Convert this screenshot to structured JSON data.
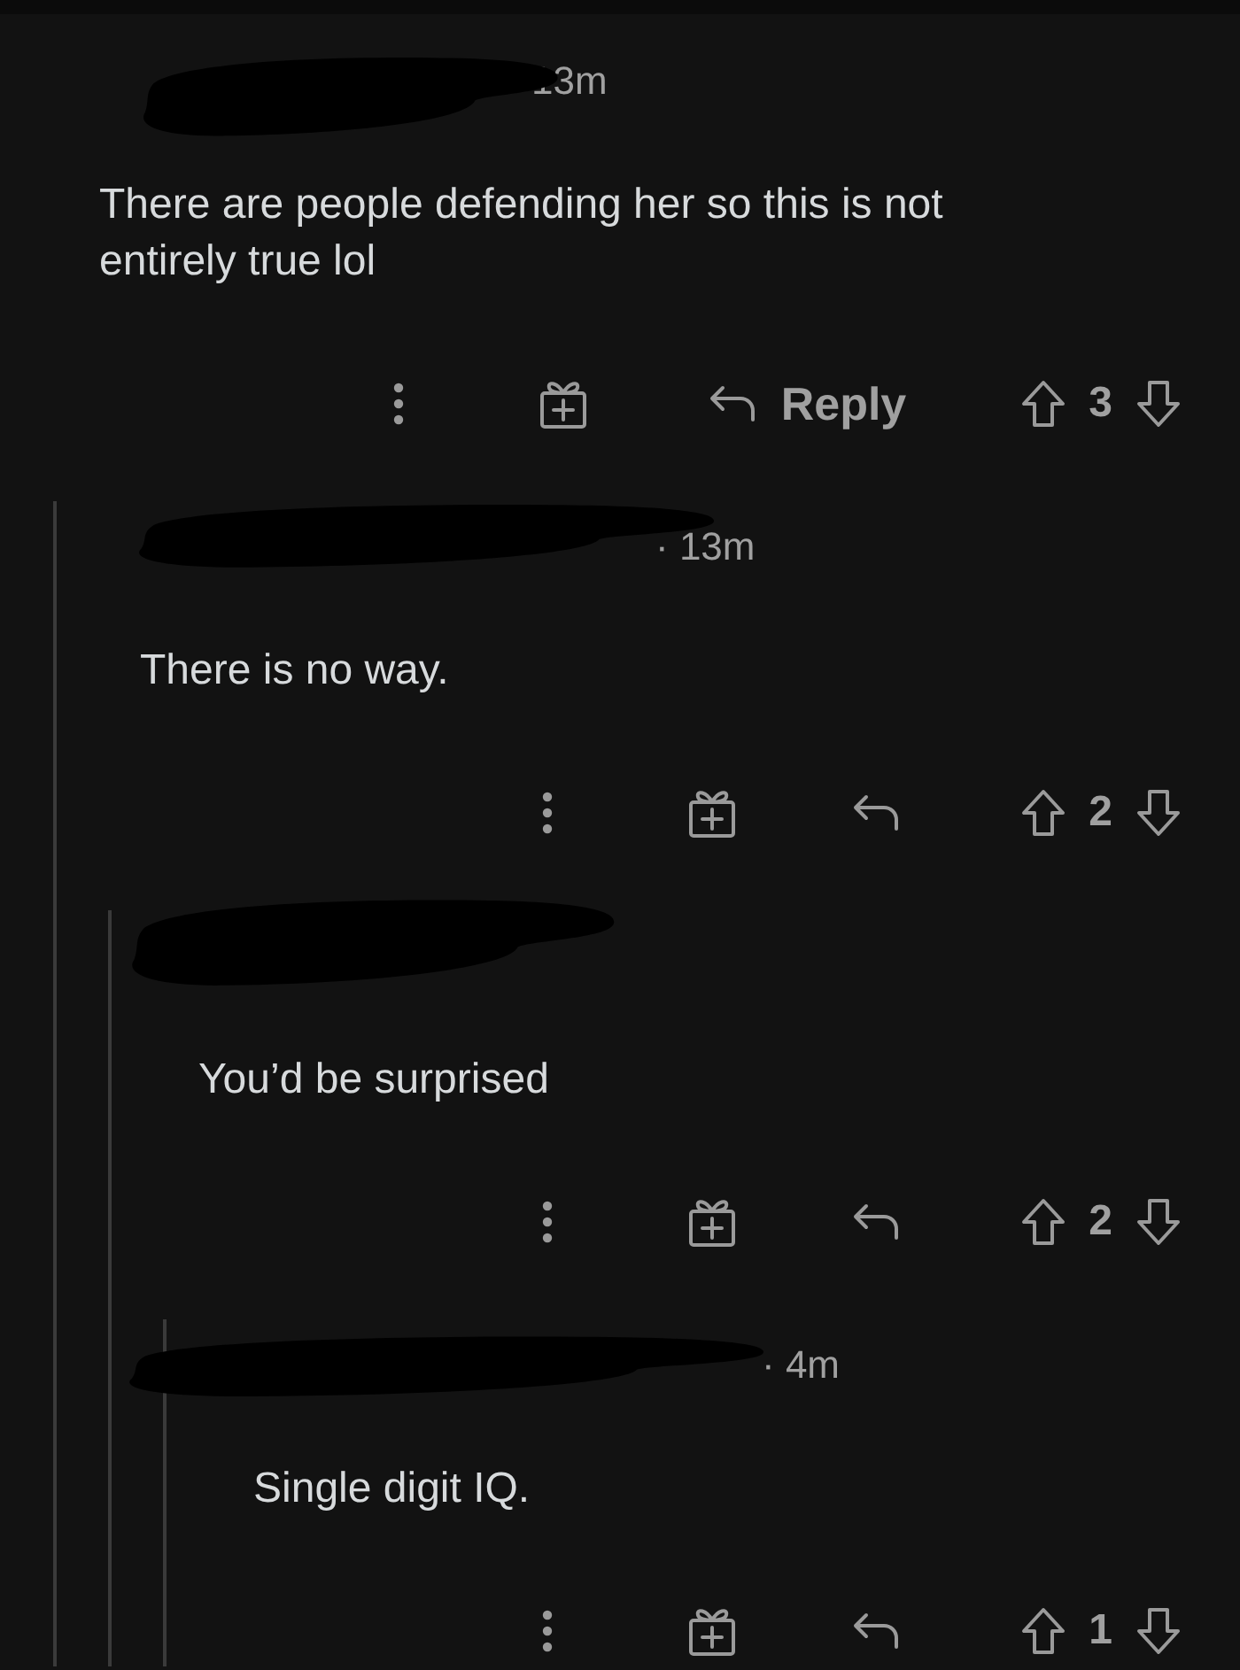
{
  "comments": [
    {
      "time": "13m",
      "body": "There are people defending her so this is not entirely true lol",
      "reply_label": "Reply",
      "score": "3",
      "children": [
        {
          "time": "· 13m",
          "body": "There is no way.",
          "score": "2",
          "children": [
            {
              "body": "You’d be surprised",
              "score": "2",
              "children": [
                {
                  "time": "· 4m",
                  "body": "Single digit IQ.",
                  "score": "1"
                }
              ]
            }
          ]
        }
      ]
    }
  ]
}
